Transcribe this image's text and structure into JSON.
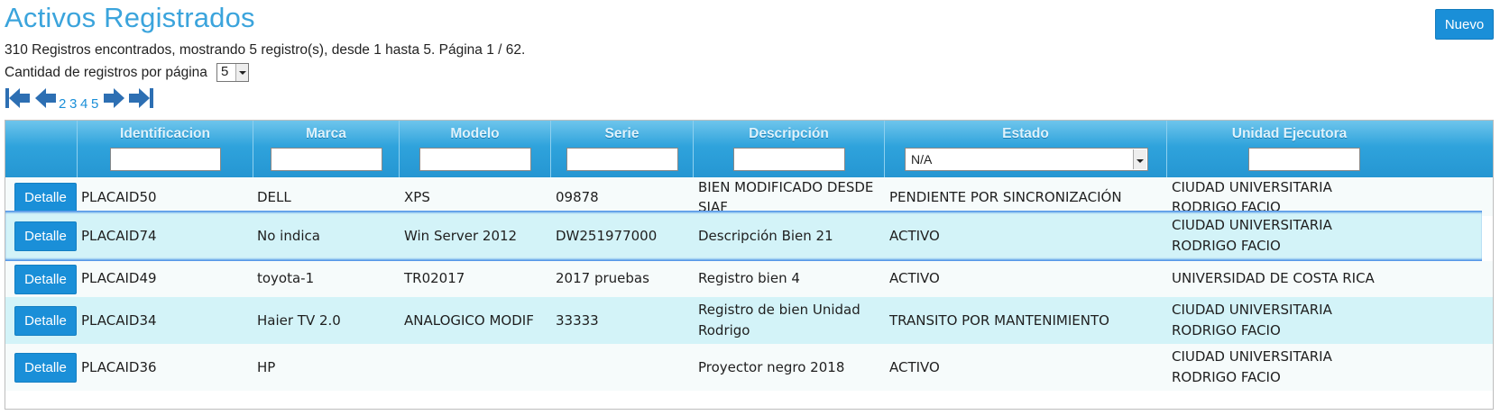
{
  "page": {
    "title": "Activos Registrados",
    "new_button": "Nuevo",
    "summary": "310 Registros encontrados, mostrando 5 registro(s), desde 1 hasta 5. Página 1 / 62.",
    "per_page_label": "Cantidad de registros por página",
    "per_page_value": "5"
  },
  "pager": {
    "first_icon": "first-page-icon",
    "prev_icon": "prev-page-icon",
    "pages": [
      "2",
      "3",
      "4",
      "5"
    ],
    "next_icon": "next-page-icon",
    "last_icon": "last-page-icon"
  },
  "table": {
    "headers": {
      "identificacion": "Identificacion",
      "marca": "Marca",
      "modelo": "Modelo",
      "serie": "Serie",
      "descripcion": "Descripción",
      "estado": "Estado",
      "unidad": "Unidad Ejecutora"
    },
    "filters": {
      "identificacion": "",
      "marca": "",
      "modelo": "",
      "serie": "",
      "descripcion": "",
      "estado": "N/A",
      "unidad": ""
    },
    "detail_label": "Detalle",
    "rows": [
      {
        "identificacion": "PLACAID50",
        "marca": "DELL",
        "modelo": "XPS",
        "serie": "09878",
        "descripcion": [
          "BIEN MODIFICADO DESDE",
          "SIAF"
        ],
        "estado": "PENDIENTE POR SINCRONIZACIÓN",
        "unidad": [
          "CIUDAD UNIVERSITARIA",
          "RODRIGO FACIO"
        ]
      },
      {
        "identificacion": "PLACAID74",
        "marca": "No indica",
        "modelo": "Win Server 2012",
        "serie": "DW251977000",
        "descripcion": [
          "Descripción Bien 21"
        ],
        "estado": "ACTIVO",
        "unidad": [
          "CIUDAD UNIVERSITARIA",
          "RODRIGO FACIO"
        ]
      },
      {
        "identificacion": "PLACAID49",
        "marca": "toyota-1",
        "modelo": "TR02017",
        "serie": "2017 pruebas",
        "descripcion": [
          "Registro bien 4"
        ],
        "estado": "ACTIVO",
        "unidad": [
          "UNIVERSIDAD DE COSTA RICA"
        ]
      },
      {
        "identificacion": "PLACAID34",
        "marca": "Haier TV 2.0",
        "modelo": "ANALOGICO MODIF",
        "serie": "33333",
        "descripcion": [
          "Registro de bien Unidad",
          "Rodrigo"
        ],
        "estado": "TRANSITO POR MANTENIMIENTO",
        "unidad": [
          "CIUDAD UNIVERSITARIA",
          "RODRIGO FACIO"
        ]
      },
      {
        "identificacion": "PLACAID36",
        "marca": "HP",
        "modelo": "",
        "serie": "",
        "descripcion": [
          "Proyector negro 2018"
        ],
        "estado": "ACTIVO",
        "unidad": [
          "CIUDAD UNIVERSITARIA",
          "RODRIGO FACIO"
        ]
      }
    ]
  }
}
